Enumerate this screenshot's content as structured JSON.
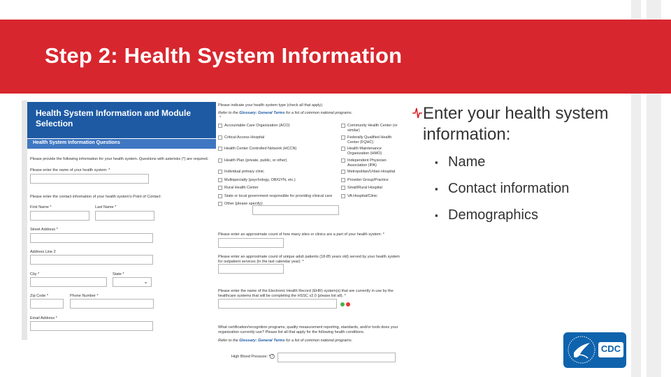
{
  "slide": {
    "title": "Step 2: Health System Information"
  },
  "form": {
    "header_title": "Health System Information and Module Selection",
    "section_title": "Health System Information Questions",
    "intro": "Please provide the following information for your health system. Questions with asterisks (*) are required.",
    "name_label": "Please enter the name of your health system: *",
    "poc_label": "Please enter the contact information of your health system's Point of Contact:",
    "first_name_label": "First Name *",
    "last_name_label": "Last Name *",
    "street_label": "Street Address *",
    "address2_label": "Address Line 2",
    "city_label": "City *",
    "state_label": "State *",
    "zip_label": "Zip Code *",
    "phone_label": "Phone Number *",
    "email_label": "Email Address *",
    "type_question": "Please indicate your health system type (check all that apply).",
    "type_glossary_prefix": "Refer to the",
    "type_glossary_link": "Glossary: General Terms",
    "type_glossary_suffix": "for a list of common national programs.",
    "type_asterisk": "*",
    "types_left": [
      "Accountable Care Organization (ACO)",
      "Critical Access Hospital",
      "Health Center Controlled Network (HCCN)",
      "Health Plan (private, public, or other)",
      "Individual primary clinic",
      "Multispecialty (psychology, OB/GYN, etc.)",
      "Rural Health Center",
      "State or local government responsible for providing clinical care",
      "Other (please specify):"
    ],
    "types_right": [
      "Community Health Center (or similar)",
      "Federally Qualified Health Center (FQHC)",
      "Health Maintenance Organization (HMO)",
      "Independent Physician Association (IPA)",
      "Metropolitan/Urban Hospital",
      "Provider Group/Practice",
      "Small/Rural Hospital",
      "VA Hospital/Clinic"
    ],
    "sites_question": "Please enter an approximate count of how many sites or clinics are a part of your health system: *",
    "patients_question": "Please enter an approximate count of unique adult patients (18-85 years old) served by your health system for outpatient services (in the last calendar year): *",
    "ehr_question": "Please enter the name of the Electronic Health Record (EHR) system(s) that are currently in use by the healthcare systems that will be completing the HSSC v2.0 (please list all). *",
    "cert_question": "What certification/recognition programs, quality measurement reporting, standards, and/or tools does your organization currently use? Please list all that apply for the following health conditions.",
    "cert_glossary_prefix": "Refer to the",
    "cert_glossary_link": "Glossary: General Terms",
    "cert_glossary_suffix": "for a list of common national programs.",
    "hbp_label": "High Blood Pressure: *"
  },
  "bullets": {
    "main": "Enter your health system information:",
    "items": [
      "Name",
      "Contact information",
      "Demographics"
    ]
  },
  "logo": {
    "text": "CDC"
  },
  "colors": {
    "banner": "#d8262e",
    "form_header": "#1d5aa3",
    "cdc_blue": "#0f63ad"
  }
}
